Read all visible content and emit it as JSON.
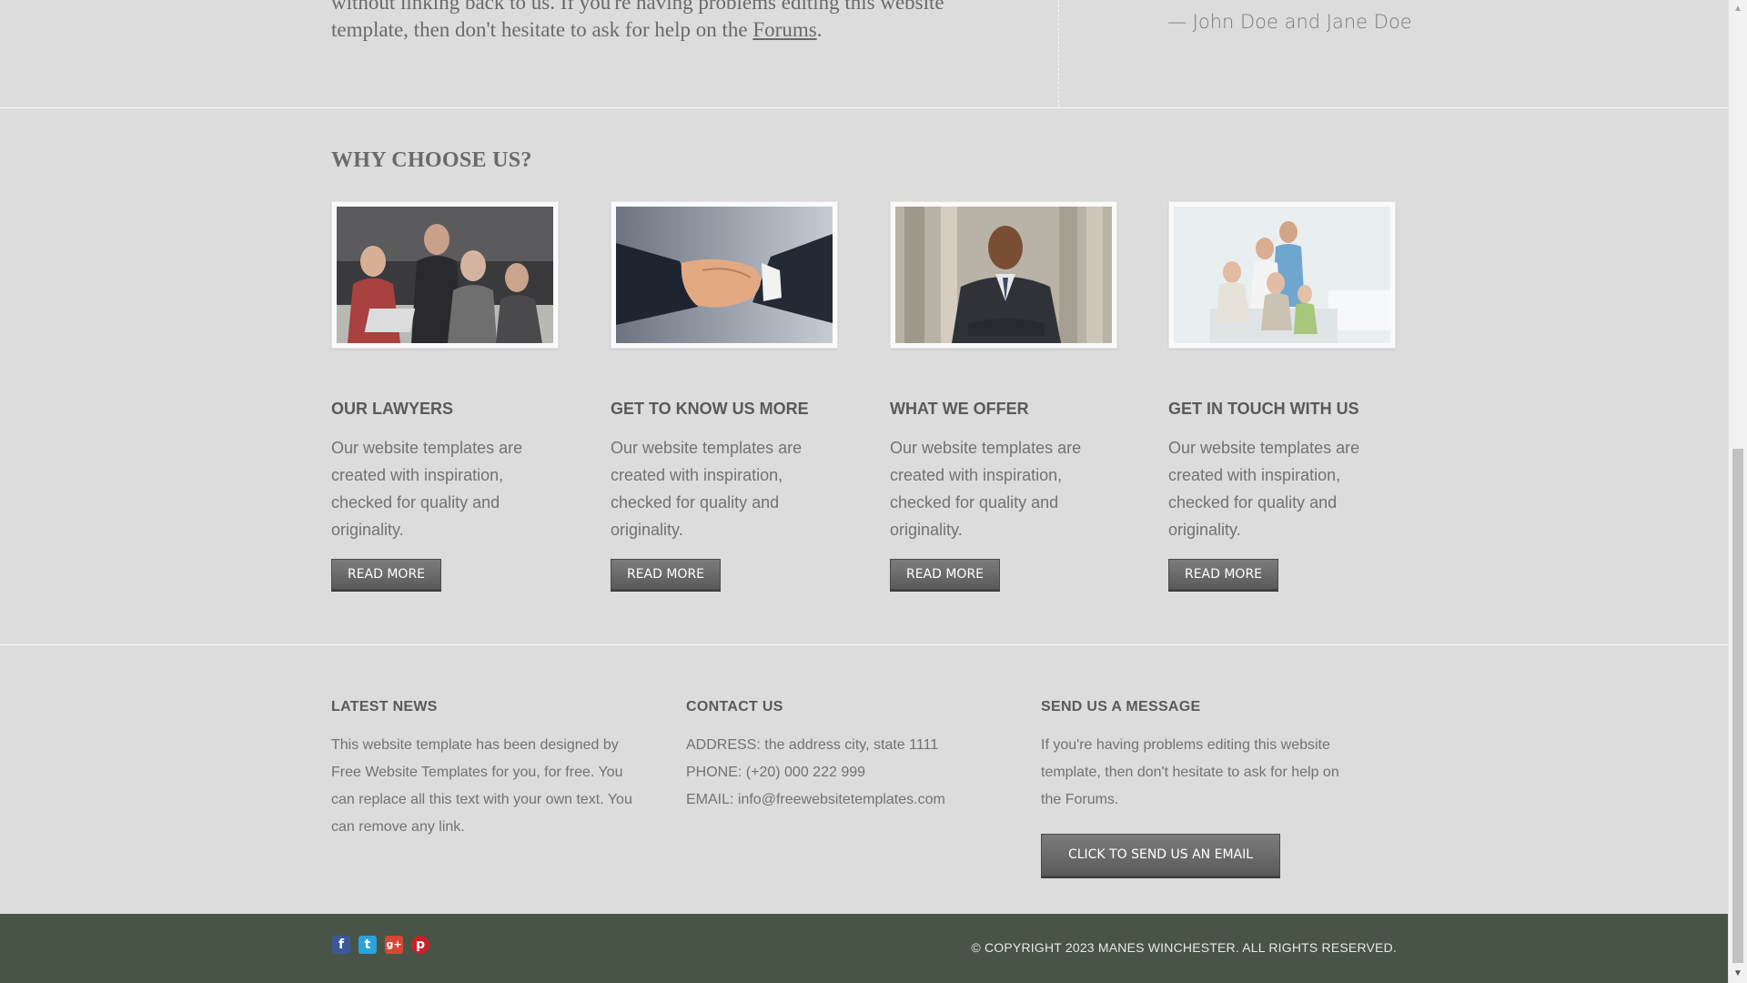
{
  "intro": {
    "text_line1": "without linking back to us. If you're having problems editing this website",
    "text_line2_prefix": "template, then don't hesitate to ask for help on the ",
    "forums_link": "Forums",
    "text_line2_suffix": ".",
    "quote_author": "— John Doe and Jane Doe"
  },
  "why": {
    "title": "WHY CHOOSE US?",
    "cards": [
      {
        "title": "OUR LAWYERS",
        "text": "Our website templates are created with inspiration, checked for quality and originality.",
        "button": "READ MORE",
        "image": "lawyers-meeting-photo"
      },
      {
        "title": "GET TO KNOW US MORE",
        "text": "Our website templates are created with inspiration, checked for quality and originality.",
        "button": "READ MORE",
        "image": "handshake-photo"
      },
      {
        "title": "WHAT WE OFFER",
        "text": "Our website templates are created with inspiration, checked for quality and originality.",
        "button": "READ MORE",
        "image": "businessman-photo"
      },
      {
        "title": "GET IN TOUCH WITH US",
        "text": "Our website templates are created with inspiration, checked for quality and originality.",
        "button": "READ MORE",
        "image": "family-photo"
      }
    ]
  },
  "news": {
    "title": "LATEST NEWS",
    "text": "This website template has been designed by Free Website Templates for you, for free. You can replace all this text with your own text. You can remove any link."
  },
  "contact": {
    "title": "CONTACT US",
    "address": "ADDRESS: the address city, state 1111",
    "phone": "PHONE: (+20) 000 222 999",
    "email": "EMAIL: info@freewebsitetemplates.com"
  },
  "message": {
    "title": "SEND US A MESSAGE",
    "text": "If you're having problems editing this website template, then don't hesitate to ask for help on the Forums.",
    "button": "CLICK TO SEND US AN EMAIL"
  },
  "footer": {
    "social": [
      {
        "name": "facebook-icon",
        "glyph": "f",
        "color": "#3b5998"
      },
      {
        "name": "twitter-icon",
        "glyph": "t",
        "color": "#2aa3d9"
      },
      {
        "name": "google-plus-icon",
        "glyph": "g+",
        "color": "#d34836"
      },
      {
        "name": "pinterest-icon",
        "glyph": "p",
        "color": "#cb2027"
      }
    ],
    "copyright": "© COPYRIGHT 2023 MANES WINCHESTER. ALL RIGHTS RESERVED."
  },
  "colors": {
    "background": "#dcdcdc",
    "footer_bar": "#485445",
    "button": "#666666"
  }
}
